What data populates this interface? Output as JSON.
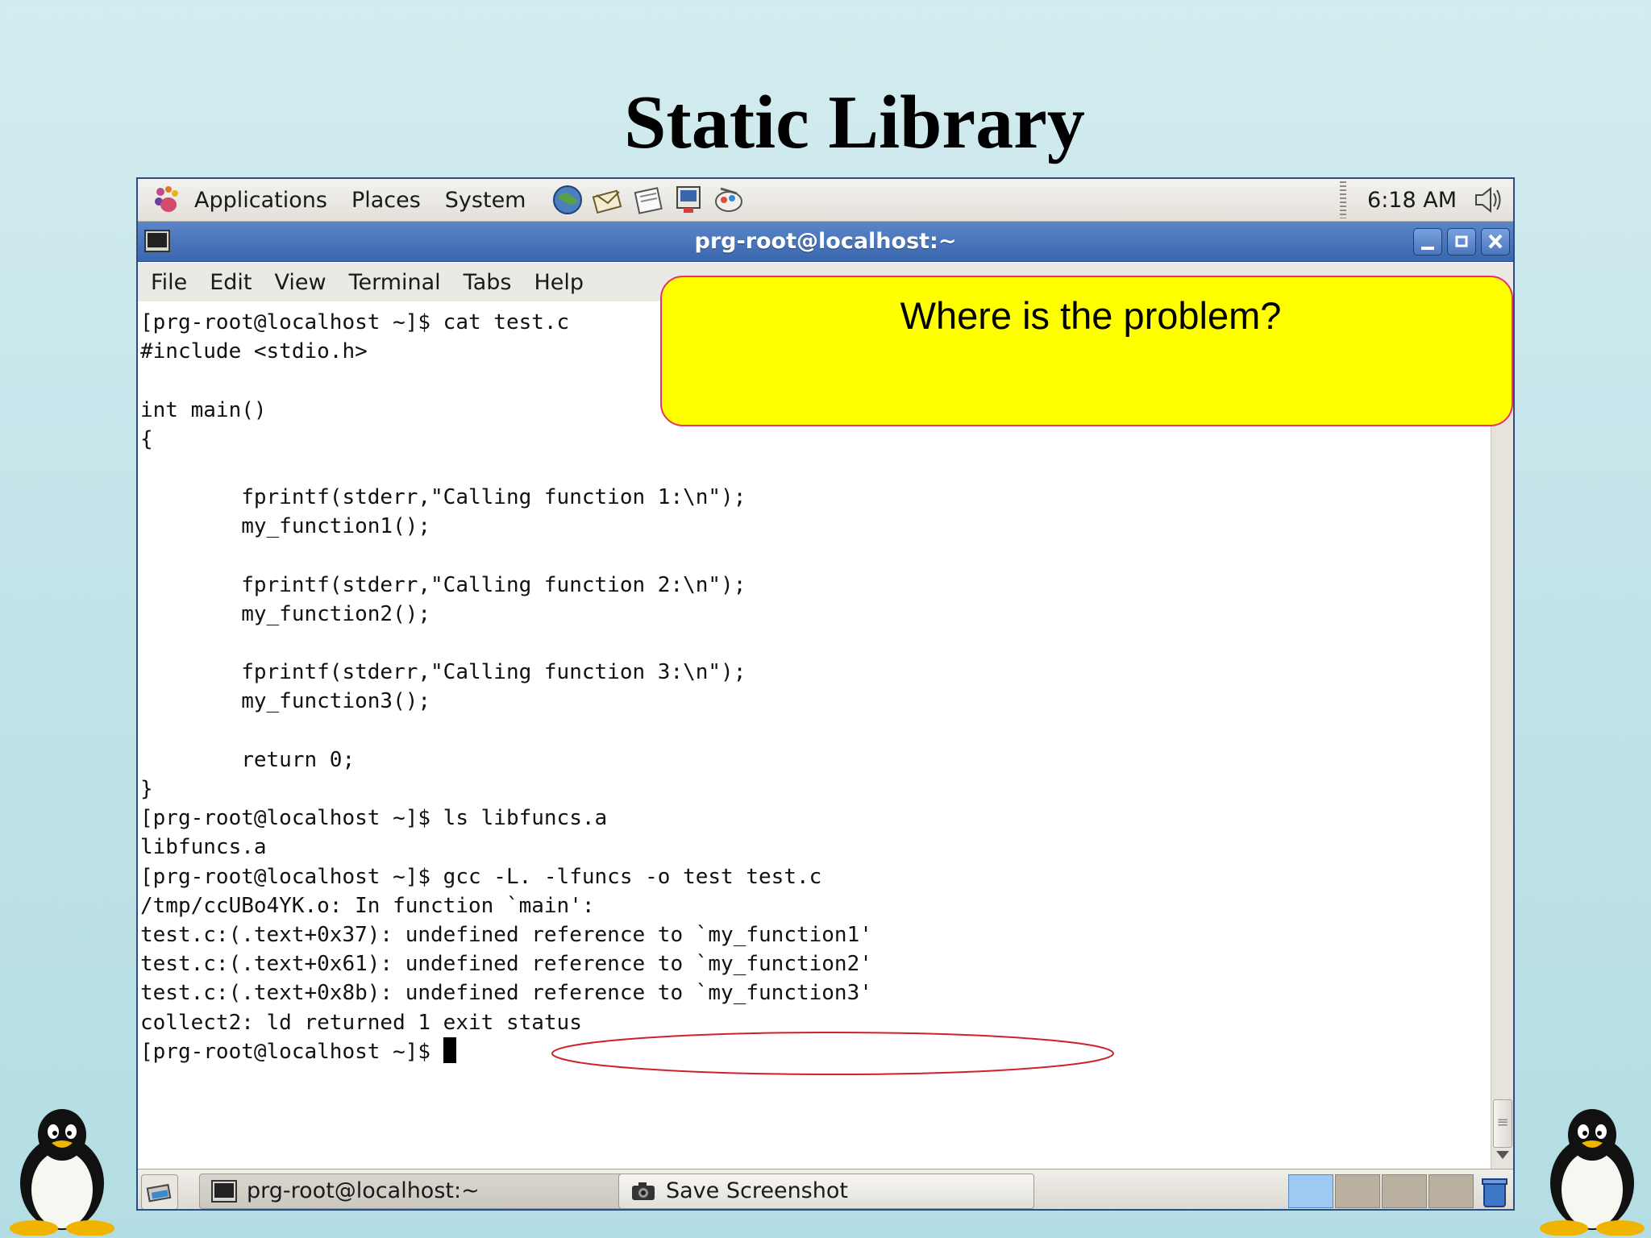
{
  "slide": {
    "title": "Static Library"
  },
  "top_panel": {
    "menus": [
      "Applications",
      "Places",
      "System"
    ],
    "launchers": [
      "web-browser-icon",
      "email-icon",
      "notes-icon",
      "presentation-icon",
      "graphics-icon"
    ],
    "clock": "6:18 AM"
  },
  "window": {
    "title": "prg-root@localhost:~"
  },
  "menubar": {
    "items": [
      "File",
      "Edit",
      "View",
      "Terminal",
      "Tabs",
      "Help"
    ]
  },
  "terminal": {
    "lines": [
      "[prg-root@localhost ~]$ cat test.c",
      "#include <stdio.h>",
      "",
      "int main()",
      "{",
      "",
      "        fprintf(stderr,\"Calling function 1:\\n\");",
      "        my_function1();",
      "",
      "        fprintf(stderr,\"Calling function 2:\\n\");",
      "        my_function2();",
      "",
      "        fprintf(stderr,\"Calling function 3:\\n\");",
      "        my_function3();",
      "",
      "        return 0;",
      "}",
      "[prg-root@localhost ~]$ ls libfuncs.a",
      "libfuncs.a",
      "[prg-root@localhost ~]$ gcc -L. -lfuncs -o test test.c",
      "/tmp/ccUBo4YK.o: In function `main':",
      "test.c:(.text+0x37): undefined reference to `my_function1'",
      "test.c:(.text+0x61): undefined reference to `my_function2'",
      "test.c:(.text+0x8b): undefined reference to `my_function3'",
      "collect2: ld returned 1 exit status",
      "[prg-root@localhost ~]$ "
    ]
  },
  "callout": {
    "text": "Where is the problem?"
  },
  "taskbar": {
    "tasks": [
      "prg-root@localhost:~",
      "Save Screenshot"
    ]
  },
  "colors": {
    "callout_fill": "#ffff00",
    "callout_border": "#e8336a",
    "titlebar": "#3a66ad",
    "highlight_ellipse": "#d0202a"
  }
}
